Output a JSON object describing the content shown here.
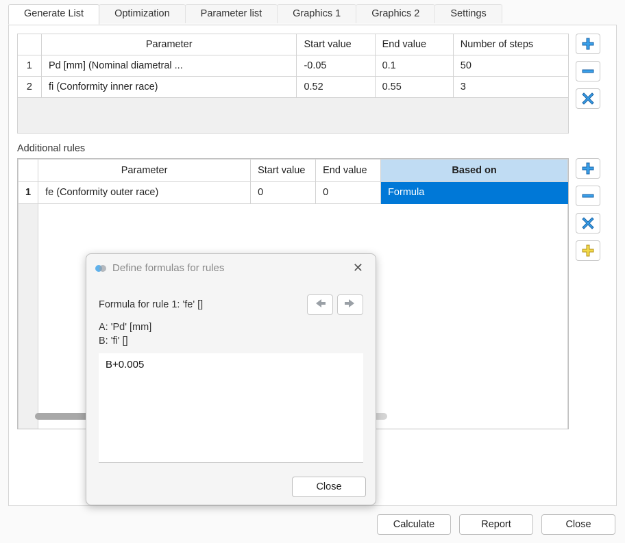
{
  "tabs": [
    "Generate List",
    "Optimization",
    "Parameter list",
    "Graphics 1",
    "Graphics 2",
    "Settings"
  ],
  "activeTab": 0,
  "top_table": {
    "headers": {
      "param": "Parameter",
      "sv": "Start value",
      "ev": "End value",
      "ns": "Number of steps"
    },
    "rows": [
      {
        "idx": "1",
        "param": "Pd [mm]  (Nominal diametral ...",
        "sv": "-0.05",
        "ev": "0.1",
        "ns": "50"
      },
      {
        "idx": "2",
        "param": "fi (Conformity inner race)",
        "sv": "0.52",
        "ev": "0.55",
        "ns": "3"
      }
    ]
  },
  "sectionLabel": "Additional rules",
  "rules_table": {
    "headers": {
      "param": "Parameter",
      "sv": "Start value",
      "ev": "End value",
      "basedon": "Based on"
    },
    "rows": [
      {
        "idx": "1",
        "param": "fe (Conformity outer race)",
        "sv": "0",
        "ev": "0",
        "basedon": "Formula"
      }
    ]
  },
  "footer": {
    "calculate": "Calculate",
    "report": "Report",
    "close": "Close"
  },
  "dialog": {
    "title": "Define formulas for rules",
    "formula_label": "Formula for rule 1: 'fe' []",
    "varA": "A: 'Pd' [mm]",
    "varB": "B: 'fi' []",
    "formula": "B+0.005",
    "close": "Close"
  },
  "icons": {
    "plus": "plus-icon",
    "minus": "minus-icon",
    "x": "x-icon",
    "plusy": "plus-yellow-icon",
    "arrowL": "arrow-left-icon",
    "arrowR": "arrow-right-icon",
    "close": "close-icon"
  }
}
